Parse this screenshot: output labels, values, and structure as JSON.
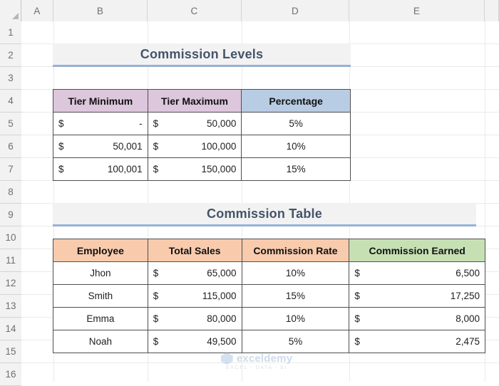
{
  "spreadsheet": {
    "column_headers": [
      "A",
      "B",
      "C",
      "D",
      "E"
    ],
    "row_headers": [
      "1",
      "2",
      "3",
      "4",
      "5",
      "6",
      "7",
      "8",
      "9",
      "10",
      "11",
      "12",
      "13",
      "14",
      "15",
      "16"
    ],
    "select_all_icon": "select-all-triangle-icon"
  },
  "colors": {
    "header_pink": "#ddc7dc",
    "header_blue": "#b8cce4",
    "header_orange": "#f8cbad",
    "header_green": "#c6e0b4",
    "title_text": "#44546a",
    "title_band_bg": "#f2f2f2",
    "title_underline": "#95b3d7",
    "cell_border": "#4f4f4f"
  },
  "titles": {
    "commission_levels": "Commission Levels",
    "commission_table": "Commission Table"
  },
  "commission_levels": {
    "headers": [
      "Tier Minimum",
      "Tier Maximum",
      "Percentage"
    ],
    "rows": [
      {
        "tier_min_currency": "$",
        "tier_min": "-",
        "tier_max_currency": "$",
        "tier_max": "50,000",
        "percentage": "5%"
      },
      {
        "tier_min_currency": "$",
        "tier_min": "50,001",
        "tier_max_currency": "$",
        "tier_max": "100,000",
        "percentage": "10%"
      },
      {
        "tier_min_currency": "$",
        "tier_min": "100,001",
        "tier_max_currency": "$",
        "tier_max": "150,000",
        "percentage": "15%"
      }
    ]
  },
  "commission_table": {
    "headers": [
      "Employee",
      "Total Sales",
      "Commission Rate",
      "Commission Earned"
    ],
    "rows": [
      {
        "employee": "Jhon",
        "sales_currency": "$",
        "total_sales": "65,000",
        "commission_rate": "10%",
        "earned_currency": "$",
        "commission_earned": "6,500"
      },
      {
        "employee": "Smith",
        "sales_currency": "$",
        "total_sales": "115,000",
        "commission_rate": "15%",
        "earned_currency": "$",
        "commission_earned": "17,250"
      },
      {
        "employee": "Emma",
        "sales_currency": "$",
        "total_sales": "80,000",
        "commission_rate": "10%",
        "earned_currency": "$",
        "commission_earned": "8,000"
      },
      {
        "employee": "Noah",
        "sales_currency": "$",
        "total_sales": "49,500",
        "commission_rate": "5%",
        "earned_currency": "$",
        "commission_earned": "2,475"
      }
    ]
  },
  "watermark": {
    "name": "exceldemy",
    "tagline": "EXCEL - DATA - BI",
    "logo_icon": "cube-logo-icon"
  }
}
